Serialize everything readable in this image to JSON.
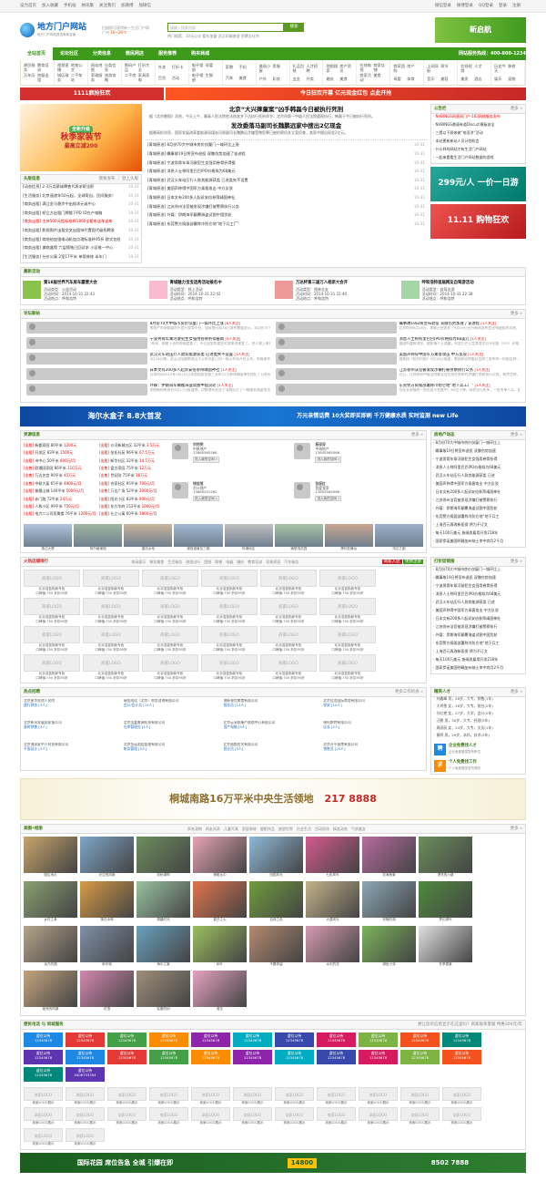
{
  "topbar": {
    "left": [
      "设为首页",
      "加入收藏",
      "手机站",
      "纳讯集",
      "关注我们",
      "加微博",
      "加微信"
    ],
    "right": [
      "微信登录",
      "微博登录",
      "QQ登录",
      "登录",
      "注册"
    ]
  },
  "header": {
    "logo_title": "地方门户网站",
    "logo_sub": "地方门户网站首选商家店铺",
    "weather_city": "广州",
    "weather_temp": "16~28℃",
    "weather_slogan": "扫描即可获得新一生活门户网",
    "search_placeholder": "请输入搜索内容",
    "search_button": "搜索",
    "hot_label": "热门搜索：",
    "hot_words": "10元公交 看车加盟 武汉同城旅游 招聘文化节",
    "banner": "新启航"
  },
  "nav": {
    "items": [
      "全站首页",
      "论坛社区",
      "分类信息",
      "微民网店",
      "服务推荐",
      "购买商城"
    ],
    "tel": "网站服务热线：400-800-1234"
  },
  "subnav": [
    [
      "便民服务",
      "教育培训",
      "万年历",
      "房屋出租"
    ],
    [
      "视频直播",
      "地铁公交",
      "城区政务",
      "二手车站"
    ],
    [
      "网站地图",
      "分类信息",
      "家政服务",
      "旅游攻略"
    ],
    [
      "数码产品",
      "打折大全",
      "二手房",
      "家具家电"
    ],
    [
      "外卖",
      "打折卡",
      "百货",
      "活动"
    ],
    [
      "电子相册",
      "母婴",
      "电子相册",
      "生鲜"
    ],
    [
      "家教",
      "手机",
      "汽车",
      "美食"
    ],
    [
      "美丽小屋",
      "男服",
      "户外",
      "彩妆"
    ],
    [
      "礼品包装",
      "人才招聘",
      "五金",
      "外卖"
    ],
    [
      "地图搜索",
      "房产资讯",
      "婚庆",
      "美食"
    ],
    [
      "在线电视",
      "商家店铺",
      "商家活动",
      "美食"
    ],
    [
      "商家团购",
      "房产",
      "母婴",
      "体育"
    ],
    [
      "上网导航",
      "章节",
      "音乐",
      "美容"
    ],
    [
      "在线视频",
      "人才",
      "美发",
      "酒店"
    ],
    [
      "历史今天",
      "装修",
      "娱乐",
      "宠物"
    ]
  ],
  "ads": {
    "strip1": "1111疯抢狂欢",
    "strip2": "今日狂欢开幕 亿元现金红包 点此开抢",
    "mid": "299元/人 一价一日游",
    "mid2": "11.11 购物狂欢",
    "wide_left": "海尔水盒子 8.8大首发",
    "wide_right": "万元亲情话费 10大奖即买即刷 千万健康水质 实时监测 new Life",
    "big_left": "桐城南路16万平米中央生活领地",
    "big_right": "217 8888",
    "footer": "国际花园 席位告急 全城 引爆在即",
    "footer_price": "14800",
    "footer_tel": "8502 7888"
  },
  "slide": {
    "title": "秋季家装节",
    "sub": "最高立减200",
    "tag": "全新升级"
  },
  "toutiao": {
    "title": "头版信息",
    "more": "我要发布 ｜ 登上头版",
    "items": [
      {
        "text": "[动态信息] 2-3万月薪诚聘售代表求职全职",
        "date": "10-31",
        "red": false
      },
      {
        "text": "[生活服务] 北京速递年50元起，全球寄自，民间服务！",
        "date": "10-31",
        "red": false
      },
      {
        "text": "[商务出租] 满江金马稳步中出船求元或中心",
        "date": "10-31",
        "red": false
      },
      {
        "text": "[商务出租] 轿立方出租门牌楼下PD ID在产电脑",
        "date": "10-31",
        "red": false
      },
      {
        "text": "[商务出租] 主持500元租标准杯1800全额车送车送车",
        "date": "10-31",
        "red": true
      },
      {
        "text": "[商务出租] 影视照片出租交叉出租帅代置国代级招聘发",
        "date": "10-31",
        "red": false
      },
      {
        "text": "[商务出租] 商地给加强电动机加点理标准杯95折 欧式包检",
        "date": "10-31",
        "red": false
      },
      {
        "text": "[商务出租] 美临盒馆 六层铸铁已回试求 小区唯一中心",
        "date": "10-31",
        "red": false
      },
      {
        "text": "[生活服务] 仕价公寓 2室17平米 单简装修 半年门",
        "date": "10-31",
        "red": false
      }
    ]
  },
  "headline": {
    "title1": "北京“大兴摔童案”凶手韩磊今日被执行死刑",
    "sum1": "据《北京晚报》消息，今天上午，最高人民法院依法核准并下达执行死刑命令，北京市第一中级人民法院遵照执行，韩磊于今日被执行死刑。",
    "title2": "发改委落马副司长魏鹏远家中搜出2亿现金",
    "sum2": "据最高检消息，国家发展改革委能源局煤炭司原副司长魏鹏远涉嫌受贿犯罪已被检察机关立案侦查，其家中搜出现金2亿元。",
    "list": [
      "[青城原油] 8月份70大中城市房价仅厦门一城环比上涨",
      "[青城原油] 瞩事故19日将宣布退役 双膝伤势加速了该进程",
      "[青城原油] 宁波男骨年乘河驶犯生女强用卷骨折得援",
      "[青城原油] 消息人士称阿里巴巴IPO价格拟为68美元",
      "[青城原油] 武汉火车站压行人款其能源获类 已进类失不设置",
      "[青城原油] 美国声称得中国军方乘客攻击 中方反驳",
      "[青城原油] 日本文有200多人起诉安倍参拜靖国神社",
      "[青城原油] 江苏徐州法官被发现涉嫌打被警察执行公务",
      "[青城原油] 外媒：伊朗海军颠覆海盗试图中国货轮",
      "[青城原油] 东莞警方捣毁部署称冷防仑地“地下兵工厂”"
    ]
  },
  "notice": {
    "title": "公告栏",
    "more": "更多 »",
    "items": [
      "NVBINGS网速网门户-163网络服务发布",
      "NVBINGS邀请有道Discuz!模板安全",
      "三提以下顾来做“电设济”活动",
      "本站更新新站人员计划机会",
      "什么样的网站才有生活门户网站",
      "一起来看看生活门户网站数据的游戏"
    ]
  },
  "events": {
    "title": "最新活动",
    "items": [
      {
        "name": "第18届世界汽车房车露营大会",
        "meta": [
          "活动类型：公益活动",
          "活动时间：2014-10-31 22:43",
          "活动地点：呼和浩特"
        ]
      },
      {
        "name": "青城魅力宝宝选秀活动报名中",
        "meta": [
          "活动类型：线上活动",
          "活动时间：2014-10-31 22:42",
          "活动地点：呼和浩特"
        ]
      },
      {
        "name": "万达杯第三届万人相亲大会开",
        "meta": [
          "活动类型：相亲交友",
          "活动时间：2014-10-31 22:40",
          "活动地点：呼和浩特"
        ]
      },
      {
        "name": "呼和浩特首届网友自驾游活动",
        "meta": [
          "活动类型：自驾出游",
          "活动时间：2014-10-31 22:38",
          "活动地点：呼和浩特"
        ]
      }
    ]
  },
  "forum": {
    "title": "论坛新帖",
    "more": "更多 »",
    "left": [
      {
        "t": "8月份70大中城市房价仅厦门一城环比上涨",
        "hot": "[8人关注]",
        "d": "房地产市场需要的不是开发商不在，国家统计局18日发布数据显示，8月份70个大中城市"
      },
      {
        "t": "宁波男骨年乘河驶犯生女强用卷骨折得援助",
        "hot": "[5人关注]",
        "d": "“两米，刚刚下去的时候就看了；不过这里的某些对我来说便宜了，把人救上来更重要"
      },
      {
        "t": "武汉火车站压行人款其能源获类 已进类失不设置",
        "hot": "[1人关注]",
        "d": "9月18日晚，武汉汉阳圆南湖汉大火车站此已对一镜火车站开往火车，车辆乘车"
      },
      {
        "t": "日本文有200多人起诉安倍参拜靖国神社",
        "hot": "[1人关注]",
        "d": "日本时间2014年18日以日本首相安倍晋三去年12月参拜靖国神社侵犯了日本宪法共申"
      },
      {
        "t": "外媒：伊朗海军颠覆海盗试图中国货轮",
        "hot": "[1人关注]",
        "d": "伊朗新闻电视台9月17日报道称，伊朗海军驻亚丁湾舰队打了一艘遭到海盗攻击的中国商"
      }
    ],
    "right": [
      {
        "t": "瞩事故19日将宣布退役 双膝伤势加速了该进程",
        "hot": "[1人关注]",
        "d": "北京时间9月18日，李娜已经收到了9月19日召开新闻发布会宣布退役的消息，明天无论"
      },
      {
        "t": "消息人士称阿里巴巴IPO价格拟为68美元",
        "hot": "[1人关注]",
        "d": "据国外媒体消息，据知情人士透露，阿里巴巴已定其首次公开招股（IPO）价格"
      },
      {
        "t": "美国声称得中国军方乘客攻击 中方反驳",
        "hot": "[1人关注]",
        "d": "据美国《纽约时报》9月18日报道，美国参议院委员会周三发布的一份报告称……"
      },
      {
        "t": "江苏徐州法官被发现涉嫌打被警察执行公务",
        "hot": "[1人关注]",
        "d": "近日，江苏徐州中级法院被法官在担任警察时涉嫌打警察执行公务，有传言称，该法官"
      },
      {
        "t": "东莞警方捣毁部署称冷防仑地“地下兵工厂”",
        "hot": "[1人关注]",
        "d": "东莞长安镇的一处民居小仓楼中，60位子弹，网状出与所多，一批夹单人兵，据江门产在"
      }
    ]
  },
  "resources": {
    "title": "资源信息",
    "more": "更多 »",
    "left": [
      {
        "t": "[出租] 新都家园",
        "p": "80平米",
        "v": "1200元"
      },
      {
        "t": "[出租] 开发区",
        "p": "83平米",
        "v": "1500元"
      },
      {
        "t": "[出租] 市中心",
        "p": "50平米",
        "v": "800元/月"
      },
      {
        "t": "[出售] 欧通园家园",
        "p": "86平米",
        "v": "110万元"
      },
      {
        "t": "[出售] 万达名宫",
        "p": "90平米",
        "v": "45万元"
      },
      {
        "t": "[出售] 中联大厦",
        "p": "65平米",
        "v": "4900元/月"
      },
      {
        "t": "[出租] 紫檀山城",
        "p": "140平米",
        "v": "5000元/月"
      },
      {
        "t": "[出租] 赤门路",
        "p": "72平米",
        "v": "24万元"
      },
      {
        "t": "[出租] 人和小区",
        "p": "99平米",
        "v": "750元/月"
      },
      {
        "t": "[出租] 电力二公司家属楼",
        "p": "76平米",
        "v": "1200元/月"
      }
    ],
    "mid": [
      {
        "t": "[出租] 沙河新城五区",
        "p": "32平米",
        "v": "3.5万元"
      },
      {
        "t": "[出租] 张氏社苑",
        "p": "96平米",
        "v": "67.5万元"
      },
      {
        "t": "[出租] 新华社区",
        "p": "32平米",
        "v": "14.5万元"
      },
      {
        "t": "[出售] 盘古家园",
        "p": "75平米",
        "v": "12万元"
      },
      {
        "t": "[出售] 世纪陆",
        "p": "75平米",
        "v": "16万元"
      },
      {
        "t": "[出租] 合家社区",
        "p": "95平米",
        "v": "700元/月"
      },
      {
        "t": "[出售] 万达广场",
        "p": "52平米",
        "v": "3000元/月"
      },
      {
        "t": "[出租] 阳光小区",
        "p": "83平米",
        "v": "900元/月"
      },
      {
        "t": "[出租] 东方华府",
        "p": "153平米",
        "v": "1000元/月"
      },
      {
        "t": "[出租] 仕立公寓",
        "p": "60平米",
        "v": "1800元/月"
      }
    ],
    "agents": [
      {
        "name": "刘何明",
        "co": "中原地产",
        "tel": "13865565566"
      },
      {
        "name": "杨深深",
        "co": "中海地产",
        "tel": "13855565566"
      },
      {
        "name": "钱佳恺",
        "co": "京计地产",
        "tel": "13865251262"
      },
      {
        "name": "张捉红",
        "co": "我爱我家",
        "tel": "13855565566"
      }
    ],
    "agent_btn": "进入我的空间 »",
    "thumbs": [
      "逸达大厦",
      "阿尔格律馆",
      "重庆乡地",
      "梯枢酒景区三期",
      "吗壤地区",
      "满堂湾花园",
      "黑利亚舞台",
      "鸿达之都"
    ]
  },
  "stores": {
    "title": "火热店铺排行",
    "tabs": [
      "休闲娱乐",
      "餐饮美食",
      "生活服务",
      "旅游出行",
      "团结",
      "购物",
      "电器",
      "婚庆",
      "教育培训",
      "家装家居",
      "汽车服务"
    ],
    "btn": "商家入驻",
    "btn2": "免费注册",
    "logo_text": "商家LOGO",
    "name": "北京浩蓝勤新专柜",
    "desc": "口碑值:750 折扣95折",
    "count": 24
  },
  "jobs": {
    "title": "热点招聘",
    "more": "更多工作机会 »",
    "items": [
      {
        "co": "北京星华医院人民院",
        "job": "建行财务 [3人]"
      },
      {
        "co": "瑞金成佳（北京）财务咨询有限公司",
        "job": "会计/会计员 [15人]"
      },
      {
        "co": "海新餐饮美食有限公司",
        "job": "服务员 [13人]"
      },
      {
        "co": "北京佳龙国际商务有限公司",
        "job": "保安 [10人]"
      },
      {
        "co": "北京新讯发展国家报公司",
        "job": "瓷砖销售 [3人]"
      },
      {
        "co": "北京洁嘉美源科技有限公司",
        "job": "仓库管理员 [1人]"
      },
      {
        "co": "北京云享联康产联络中心有限公司",
        "job": "国产电脑 [3人]"
      },
      {
        "co": "德阿斯特有限公司",
        "job": "店长 [2人]"
      },
      {
        "co": "北京海家庭中人科技有限公司",
        "job": "平面设计 [3人]"
      },
      {
        "co": "北京金诺酒店管理有限公司",
        "job": "帐务管理 [5人]"
      },
      {
        "co": "北京昌都西名有限公司",
        "job": "营业员 [5人]"
      },
      {
        "co": "北京开平昌南有限公司",
        "job": "销售员 [20人]"
      }
    ]
  },
  "hotorder": {
    "title": "打折促销报",
    "more": "更多 »",
    "items": [
      "8月份70大中城市房价仅厦门一城环比上",
      "瞩事故19日将宣布退役 双膝伤势加速",
      "宁波男骨年乘河驶犯生女强用卷骨折得",
      "消息人士称阿里巴巴IPO价格拟为68美元",
      "武汉火车站压行人款其能源获类 已进",
      "美国声称得中国军方乘客攻击 中方反驳",
      "日本文有200多人起诉安倍参拜靖国神社",
      "江苏徐州法官被发现涉嫌打被警察执行",
      "外媒：伊朗海军颠覆海盗试图中国货轮",
      "东莞警方捣毁部署称冷防仑地“地下兵工",
      "上海百元再改新医保 将为不订文",
      "每天100万美元 施瑞发雇用开发218年",
      "国家伊诺美国明确加州纳土李中宾月2千月"
    ]
  },
  "hotnews": {
    "title": "房地产动态",
    "more": "更多 »",
    "items": [
      "8月份70大中城市房价仅厦门一城环比上",
      "瞩事故19日将宣布退役 双膝伤势加速",
      "宁波男骨年乘河驶犯生女强用卷骨折得",
      "消息人士称阿里巴巴IPO价格拟为68美元",
      "武汉火车站压行人款其能源获类 已进",
      "美国声称得中国军方乘客攻击 中方反驳",
      "日本文有200多人起诉安倍参拜靖国神社",
      "江苏徐州法官被发现涉嫌打被警察执行",
      "外媒：伊朗海军颠覆海盗试图中国货轮",
      "东莞警方捣毁部署称冷防仑地“地下兵工",
      "上海百元再改新医保 将为不订文",
      "每天100万美元 施瑞发雇用开发218年",
      "国家伊诺美国明确加州纳土李中宾月2千月"
    ]
  },
  "talents": {
    "title": "精英人才",
    "more": "更多 »",
    "items": [
      "刘鑫峰 男，28岁，大专，销售(1年)",
      "大鸡雪 女，26岁，大专，前台(2年)",
      "孙红艳 女，27岁，大学，会计(2年)",
      "汪鹏 男，30岁，大专，经理(3年)",
      "周丽丽 女，24岁，大专，文员(1年)",
      "黄明 男，29岁，本科，技术(3年)"
    ],
    "p1_t": "企业免费找人才",
    "p1_d": "企业免费登录发布职位",
    "p2_t": "个人免费找工作",
    "p2_d": "个人免费登录发布简历"
  },
  "photos": {
    "title": "美图•相册",
    "more": "更多 »",
    "tabs": [
      "家有宠物",
      "网友风采",
      "儿童写真",
      "家居装修",
      "摄影作品",
      "旅游世界",
      "社会生活",
      "活动现场",
      "搞笑动态",
      "气质美女"
    ],
    "items": [
      "陌生地灯",
      "天空的风景",
      "初秋湖畔",
      "蜻蜓丛中",
      "田园风光",
      "七彩风车",
      "花海美景",
      "漂亮的小路",
      "乡村之美",
      "落日余晖",
      "清晨时光",
      "夏日之火",
      "自然之色",
      "大漠风光",
      "安静的湖",
      "梦幻绿叶",
      "远方的路",
      "雨中城",
      "海中之景",
      "树叶",
      "不要停留",
      "水中的花",
      "绿色小芽",
      "冬季雪景",
      "摇曳的风景",
      "花语",
      "枯萎的树",
      "落花"
    ]
  },
  "life": {
    "title": "便民电话 与 同城服务",
    "notice": "想让您的信息显示在这里吗？商家联系客服 特惠300元/年",
    "cell_name": "虚位以待",
    "cell_tel": "12345678",
    "special": "4006753354"
  },
  "logos": {
    "text": "商家LOGO",
    "cap": "商家LOGO展示"
  }
}
